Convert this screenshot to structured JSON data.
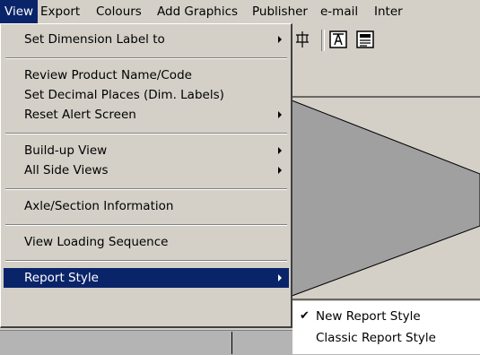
{
  "menubar": {
    "items": [
      {
        "label": "View"
      },
      {
        "label": "Export"
      },
      {
        "label": "Colours"
      },
      {
        "label": "Add Graphics"
      },
      {
        "label": "Publisher"
      },
      {
        "label": "e-mail"
      },
      {
        "label": "Inter"
      }
    ]
  },
  "toolbar": {
    "icons": [
      "grid-icon",
      "pdf-icon",
      "report-icon"
    ]
  },
  "view_menu": {
    "items": [
      {
        "label": "Set Dimension Label to",
        "submenu": true
      },
      {
        "label": "Review Product Name/Code",
        "submenu": false
      },
      {
        "label": "Set Decimal Places (Dim. Labels)",
        "submenu": false
      },
      {
        "label": "Reset Alert Screen",
        "submenu": true
      },
      {
        "label": "Build-up View",
        "submenu": true
      },
      {
        "label": "All Side Views",
        "submenu": true
      },
      {
        "label": "Axle/Section Information",
        "submenu": false
      },
      {
        "label": "View Loading Sequence",
        "submenu": false
      },
      {
        "label": "Report Style",
        "submenu": true,
        "highlighted": true
      }
    ]
  },
  "report_style_submenu": {
    "items": [
      {
        "label": "New Report Style",
        "checked": true,
        "check_icon": "checkmark-icon"
      },
      {
        "label": "Classic Report Style",
        "checked": false
      }
    ]
  },
  "colors": {
    "menu_bg": "#d4d0c8",
    "highlight": "#0a246a",
    "canvas_gray": "#a0a0a0"
  }
}
